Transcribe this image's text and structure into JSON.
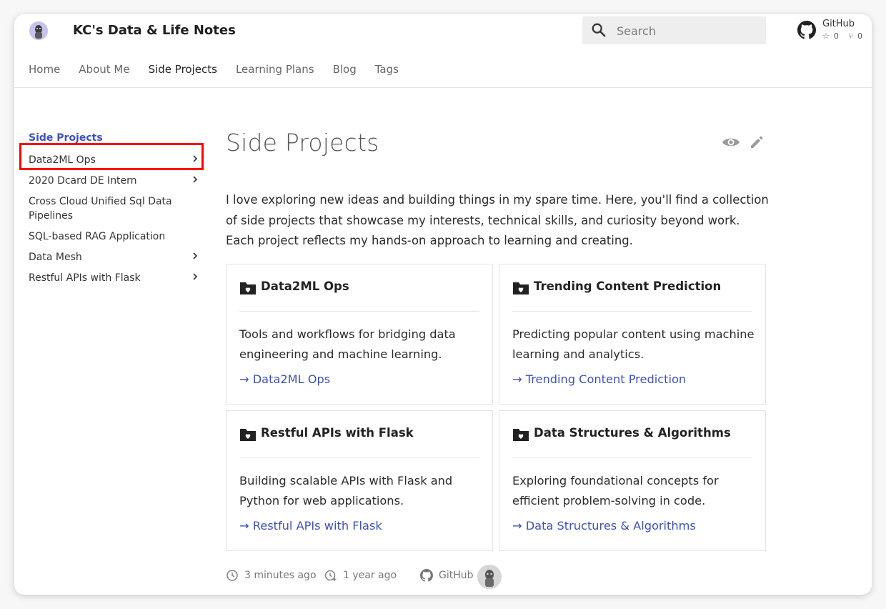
{
  "header": {
    "site_title": "KC's Data & Life Notes",
    "search_placeholder": "Search",
    "repo": {
      "name": "GitHub",
      "stars": "0",
      "forks": "0"
    }
  },
  "nav": {
    "items": [
      "Home",
      "About Me",
      "Side Projects",
      "Learning Plans",
      "Blog",
      "Tags"
    ],
    "active": "Side Projects"
  },
  "sidebar": {
    "title": "Side Projects",
    "items": [
      {
        "label": "Data2ML Ops",
        "has_children": true
      },
      {
        "label": "2020 Dcard DE Intern",
        "has_children": true
      },
      {
        "label": "Cross Cloud Unified Sql Data Pipelines",
        "has_children": false
      },
      {
        "label": "SQL-based RAG Application",
        "has_children": false
      },
      {
        "label": "Data Mesh",
        "has_children": true
      },
      {
        "label": "Restful APIs with Flask",
        "has_children": true
      }
    ]
  },
  "main": {
    "title": "Side Projects",
    "intro": "I love exploring new ideas and building things in my spare time. Here, you'll find a collection of side projects that showcase my interests, technical skills, and curiosity beyond work. Each project reflects my hands-on approach to learning and creating.",
    "cards": [
      {
        "title": "Data2ML Ops",
        "desc": "Tools and workflows for bridging data engineering and machine learning.",
        "link": "→ Data2ML Ops"
      },
      {
        "title": "Trending Content Prediction",
        "desc": "Predicting popular content using machine learning and analytics.",
        "link": "→ Trending Content Prediction"
      },
      {
        "title": "Restful APIs with Flask",
        "desc": "Building scalable APIs with Flask and Python for web applications.",
        "link": "→ Restful APIs with Flask"
      },
      {
        "title": "Data Structures & Algorithms",
        "desc": "Exploring foundational concepts for efficient problem-solving in code.",
        "link": "→ Data Structures & Algorithms"
      }
    ]
  },
  "footer": {
    "updated": "3 minutes ago",
    "created": "1 year ago",
    "github": "GitHub"
  },
  "colors": {
    "accent": "#3f51b5",
    "highlight": "#ff0000"
  }
}
